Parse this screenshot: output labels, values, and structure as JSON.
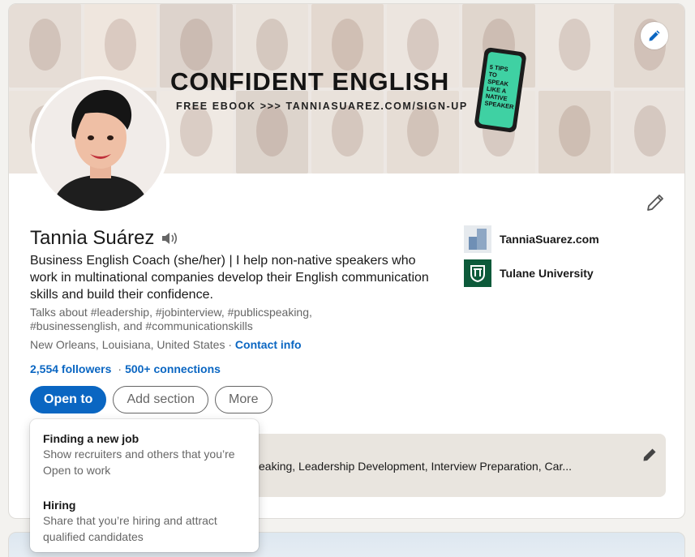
{
  "banner": {
    "title": "CONFIDENT ENGLISH",
    "subtitle": "FREE EBOOK >>> TANNIASUAREZ.COM/SIGN-UP",
    "phone_text": "5 TIPS TO\nSPEAK\nLIKE A\nNATIVE\nSPEAKER",
    "edit_icon": "pencil-icon"
  },
  "profile": {
    "name": "Tannia Suárez",
    "headline": "Business English Coach (she/her) | I help non-native speakers who work in multinational companies develop their English communication skills and build their confidence.",
    "talks_about": "Talks about #leadership, #jobinterview, #publicspeaking, #businessenglish, and #communicationskills",
    "location": "New Orleans, Louisiana, United States",
    "location_sep": " · ",
    "contact_info": "Contact info",
    "followers": "2,554 followers",
    "connections": "500+ connections",
    "stats_sep": "·"
  },
  "actions": {
    "open_to": "Open to",
    "add_section": "Add section",
    "more": "More"
  },
  "affiliations": [
    {
      "label": "TanniaSuarez.com"
    },
    {
      "label": "Tulane University"
    }
  ],
  "open_to_box": {
    "text": "c Speaking, Leadership Development, Interview Preparation, Car..."
  },
  "dropdown": [
    {
      "title": "Finding a new job",
      "desc": "Show recruiters and others that you’re Open to work"
    },
    {
      "title": "Hiring",
      "desc": "Share that you’re hiring and attract qualified candidates"
    }
  ],
  "colors": {
    "primary": "#0a66c2",
    "muted_text": "#666666",
    "text": "#191919",
    "phone_screen": "#3fd1a3",
    "tulane_green": "#0d5a3a"
  }
}
